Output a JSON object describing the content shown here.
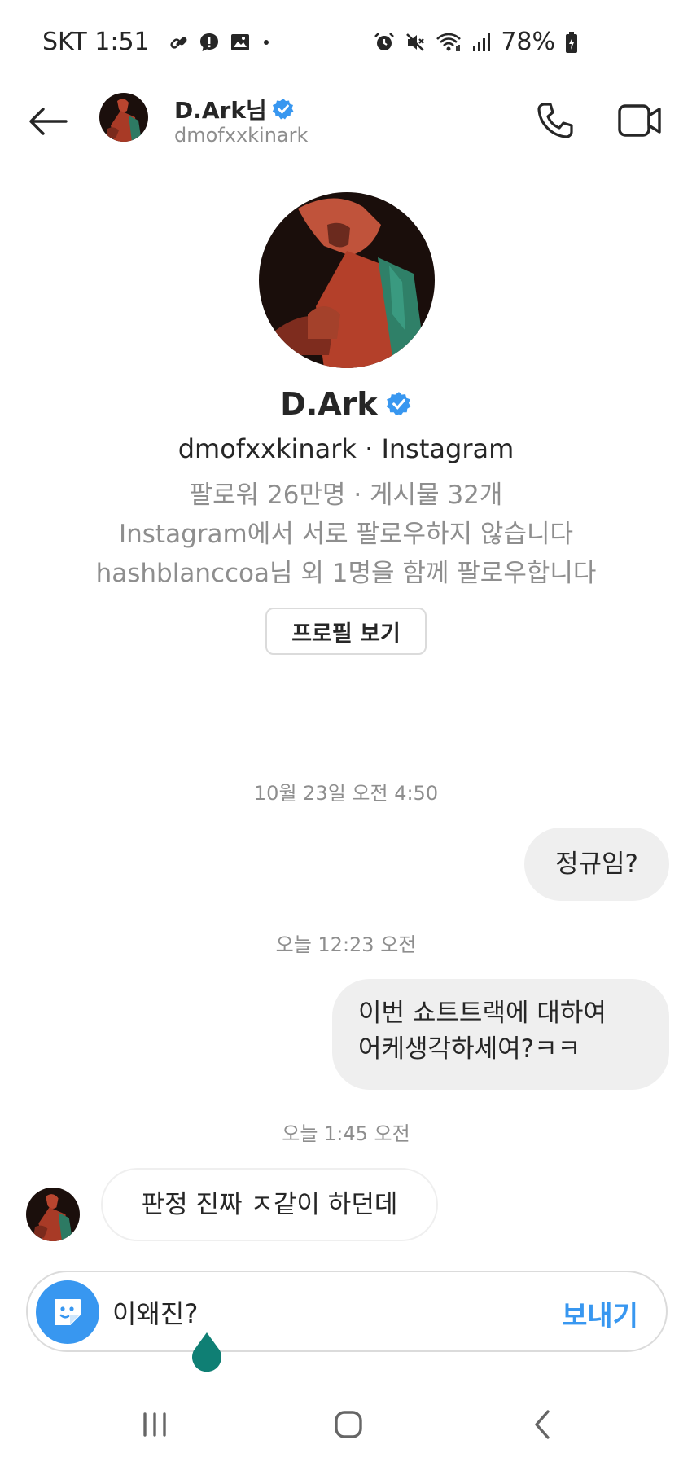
{
  "status_bar": {
    "carrier_time": "SKT 1:51",
    "battery": "78%",
    "icons_left": [
      "link-icon",
      "alert-icon",
      "image-icon",
      "dot-icon"
    ],
    "icons_right": [
      "alarm-icon",
      "mute-icon",
      "wifi-icon",
      "signal-icon",
      "battery-icon"
    ]
  },
  "header": {
    "name": "D.Ark님",
    "username": "dmofxxkinark"
  },
  "profile": {
    "name": "D.Ark",
    "username_line": "dmofxxkinark · Instagram",
    "stats": "팔로워 26만명 · 게시물 32개",
    "follow_status": "Instagram에서 서로 팔로우하지 않습니다",
    "mutual": "hashblanccoa님 외 1명을 함께 팔로우합니다",
    "view_profile_label": "프로필 보기"
  },
  "messages": {
    "timestamp_1": "10월 23일 오전 4:50",
    "msg_1": "정규임?",
    "timestamp_2": "오늘 12:23 오전",
    "msg_2_line1": "이번 쇼트트랙에 대하여",
    "msg_2_line2": "어케생각하세여?ㅋㅋ",
    "timestamp_3": "오늘 1:45 오전",
    "msg_3": "판정 진짜 ㅈ같이 하던데"
  },
  "composer": {
    "value": "이왜진?",
    "send_label": "보내기"
  },
  "colors": {
    "accent": "#3897f0",
    "bubble": "#efefef",
    "secondary_text": "#8e8e8e",
    "verified": "#3897f0",
    "cursor_handle": "#0f7f74"
  }
}
